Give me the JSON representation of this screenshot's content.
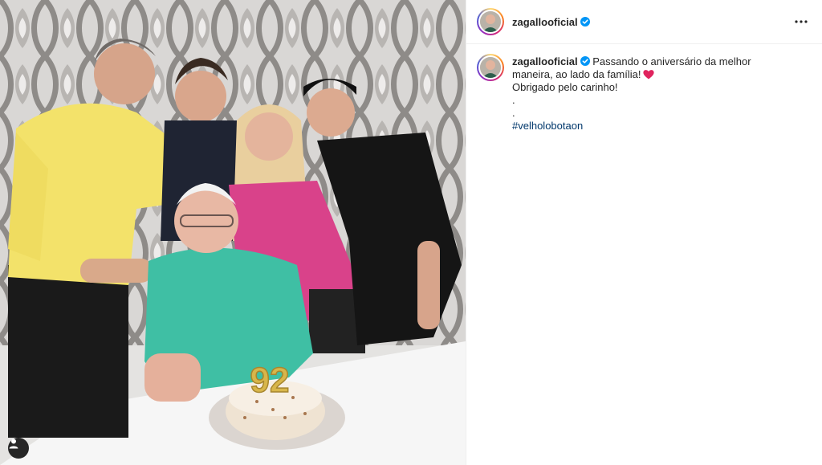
{
  "post": {
    "author": "zagallooficial",
    "verified": true,
    "photo": {
      "cake_number": "92"
    }
  },
  "caption": {
    "author": "zagallooficial",
    "text_line1": "Passando o aniversário da melhor maneira, ao lado da família!",
    "text_line2": "Obrigado pelo carinho!",
    "dot1": ".",
    "dot2": ".",
    "hashtag": "#velholobotaon"
  },
  "icons": {
    "verified": "verified-badge-icon",
    "more": "more-options-icon",
    "heart": "red-heart-emoji",
    "tag": "user-tag-icon"
  },
  "colors": {
    "verified": "#0095f6",
    "hashtag": "#00376b",
    "heart": "#e0245e",
    "text": "#262626"
  }
}
